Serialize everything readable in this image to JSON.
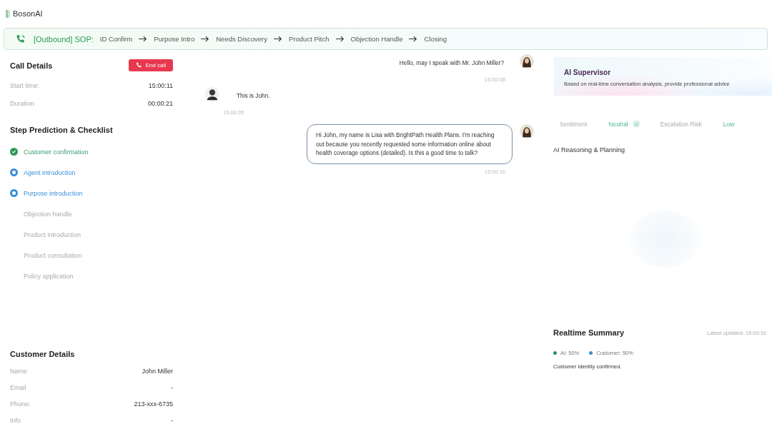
{
  "brand": "BosonAI",
  "sop": {
    "label": "[Outbound] SOP:",
    "steps": [
      "ID Confirm",
      "Purpose Intro",
      "Needs Discovery",
      "Product Pitch",
      "Objection Handle",
      "Closing"
    ]
  },
  "call_details": {
    "title": "Call Details",
    "end_button": "End call",
    "fields": [
      {
        "label": "Start time:",
        "value": "15:00:11"
      },
      {
        "label": "Duration",
        "value": "00:00:21"
      }
    ]
  },
  "checklist": {
    "title": "Step Prediction & Checklist",
    "items": [
      {
        "label": "Customer confirmation",
        "kind": "done"
      },
      {
        "label": "Agent introduction",
        "kind": "active"
      },
      {
        "label": "Purpose introduction",
        "kind": "active"
      },
      {
        "label": "Objection handle",
        "kind": "pending"
      },
      {
        "label": "Product introduction",
        "kind": "pending"
      },
      {
        "label": "Product consultation",
        "kind": "pending"
      },
      {
        "label": "Policy application",
        "kind": "pending"
      }
    ]
  },
  "customer_details": {
    "title": "Customer Details",
    "fields": [
      {
        "label": "Name",
        "value": "John Miller"
      },
      {
        "label": "Email",
        "value": "-"
      },
      {
        "label": "Phone:",
        "value": "213-xxx-6735"
      },
      {
        "label": "Info",
        "value": "-"
      }
    ]
  },
  "messages": [
    {
      "kind": "agent",
      "text": "Hello, may I speak with Mr. John Miller?",
      "time": "15:00:08",
      "boxed": false
    },
    {
      "kind": "customer",
      "text": "This is John.",
      "time": "15:00:05",
      "boxed": false
    },
    {
      "kind": "agent",
      "text": "Hi John, my name is Lisa with BrightPath Health Plans. I'm reaching out because you recently requested some information online about health coverage options (detailed). Is this a good time to talk?",
      "time": "15:00:10",
      "boxed": true
    }
  ],
  "supervisor": {
    "title": "AI Supervisor",
    "subtitle": "Based on real-time conversation analysis, provide professional advice",
    "sentiment_label": "Sentiment",
    "sentiment_value": "Neutral",
    "risk_label": "Escalation Risk",
    "risk_value": "Low",
    "reasoning_title": "AI Reasoning & Planning"
  },
  "summary": {
    "title": "Realtime Summary",
    "updated": "Latest updated: 15:00:10",
    "legend": [
      {
        "label": "AI: 50%",
        "color": "#2e8b6e"
      },
      {
        "label": "Customer: 50%",
        "color": "#3a8fd8"
      }
    ],
    "text": "Customer identity confirmed."
  }
}
